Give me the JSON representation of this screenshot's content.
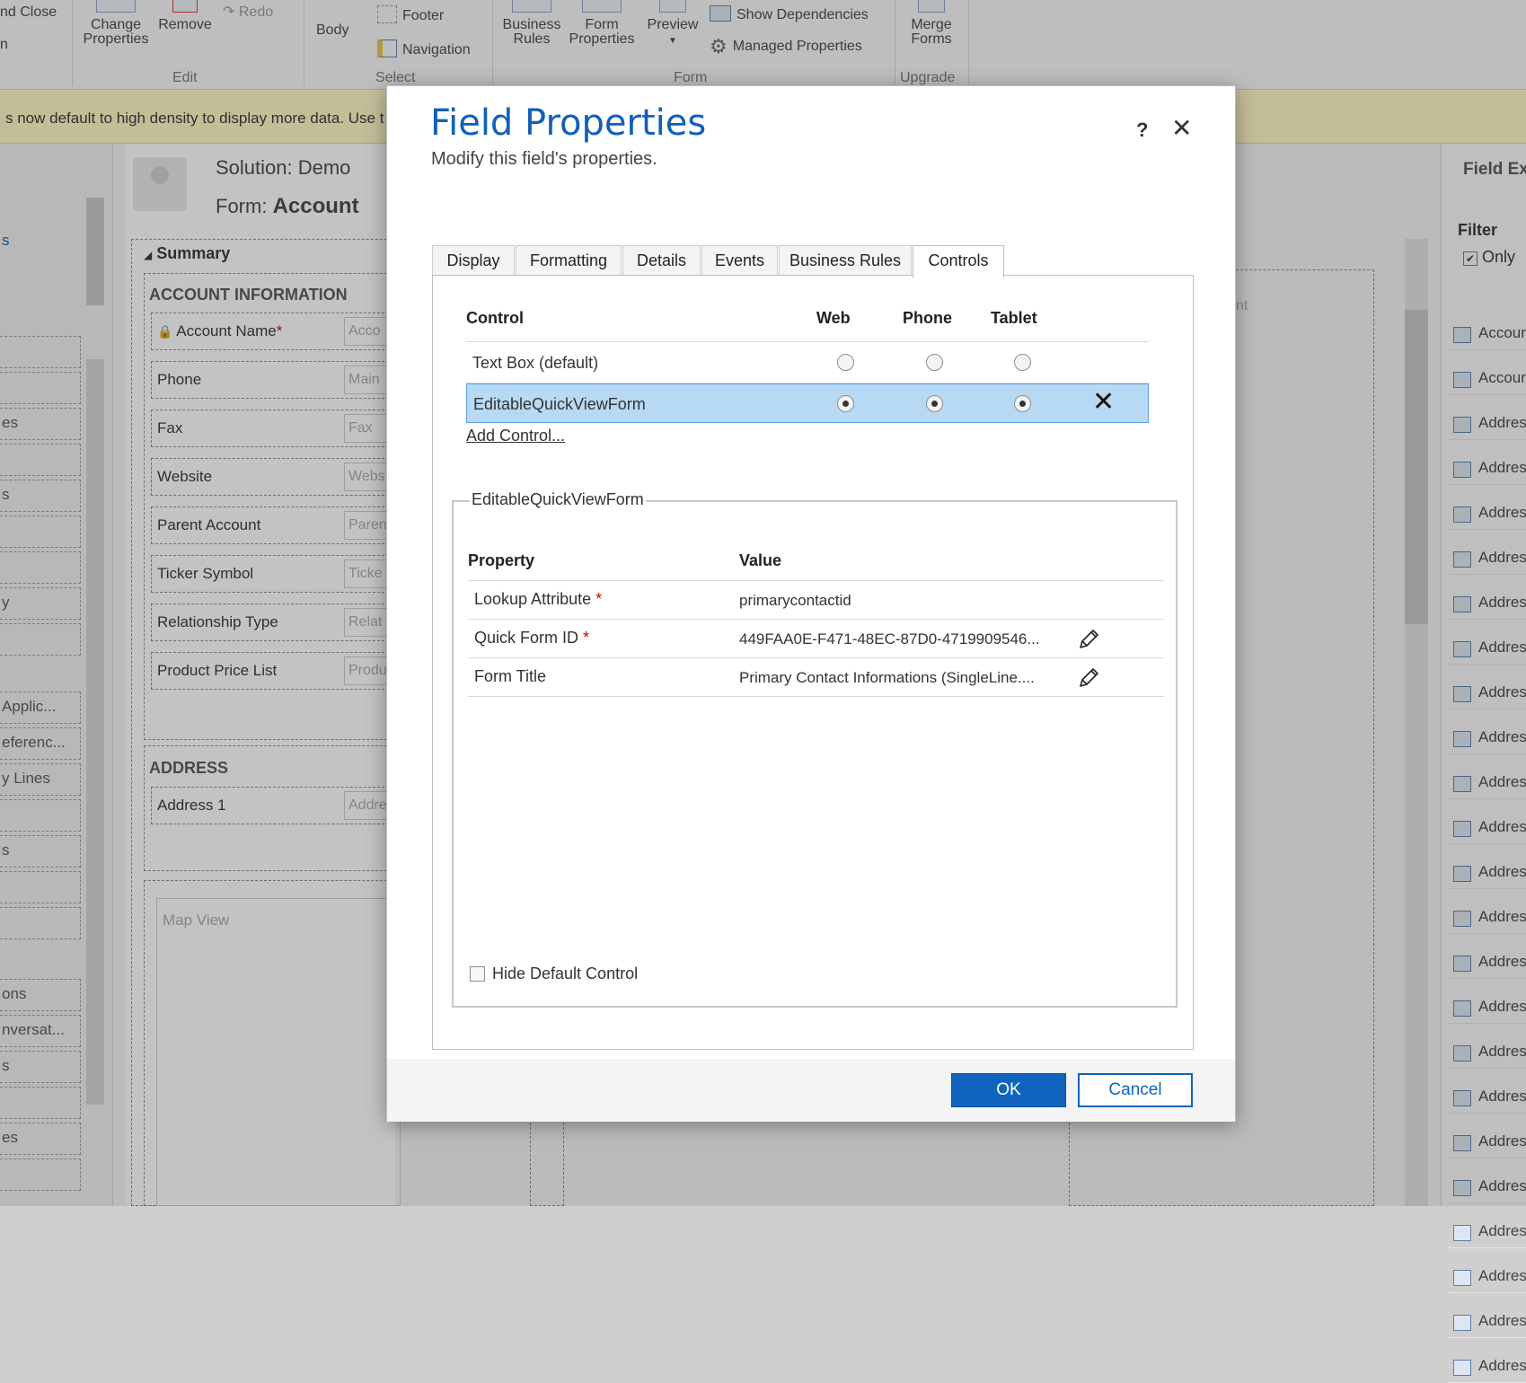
{
  "ribbon": {
    "save_close": "nd Close",
    "cut_label": "n",
    "change_properties": [
      "Change",
      "Properties"
    ],
    "remove": "Remove",
    "redo": "Redo",
    "edit_group": "Edit",
    "body": "Body",
    "footer": "Footer",
    "navigation": "Navigation",
    "select_group": "Select",
    "business_rules": [
      "Business",
      "Rules"
    ],
    "form_properties": [
      "Form",
      "Properties"
    ],
    "preview": "Preview",
    "show_dependencies": "Show Dependencies",
    "managed_properties": "Managed Properties",
    "form_group": "Form",
    "merge_forms": [
      "Merge",
      "Forms"
    ],
    "upgrade_group": "Upgrade"
  },
  "notice": {
    "text": "s now default to high density to display more data. Use t"
  },
  "left_nav": {
    "items": [
      "s",
      "es",
      "s",
      "y",
      "Applic...",
      "eferenc...",
      "y Lines",
      "s",
      "ons",
      "nversat...",
      "s",
      "es"
    ]
  },
  "form_canvas": {
    "solution_label": "Solution: Demo",
    "form_prefix": "Form:",
    "form_name": "Account",
    "summary_tab": "Summary",
    "account_section": "ACCOUNT INFORMATION",
    "fields": [
      {
        "label": "Account Name",
        "required": "*",
        "placeholder": "Acco"
      },
      {
        "label": "Phone",
        "required": "",
        "placeholder": "Main"
      },
      {
        "label": "Fax",
        "required": "",
        "placeholder": "Fax"
      },
      {
        "label": "Website",
        "required": "",
        "placeholder": "Webs"
      },
      {
        "label": "Parent Account",
        "required": "",
        "placeholder": "Paren"
      },
      {
        "label": "Ticker Symbol",
        "required": "",
        "placeholder": "Ticke"
      },
      {
        "label": "Relationship Type",
        "required": "",
        "placeholder": "Relat"
      },
      {
        "label": "Product Price List",
        "required": "",
        "placeholder": "Produ"
      }
    ],
    "address_section": "ADDRESS",
    "address_field": {
      "label": "Address 1",
      "placeholder": "Addre"
    },
    "map_view": "Map View",
    "right_hint": "nt"
  },
  "field_explorer": {
    "title": "Field Ex",
    "filter_label": "Filter",
    "only_label": "Only",
    "items": [
      "Accour",
      "Accour",
      "Addres",
      "Addres",
      "Addres",
      "Addres",
      "Addres",
      "Addres",
      "Addres",
      "Addres",
      "Addres",
      "Addres",
      "Addres",
      "Addres",
      "Addres",
      "Addres",
      "Addres",
      "Addres",
      "Addres",
      "Addres",
      "Addres",
      "Addres",
      "Addres",
      "Addres"
    ]
  },
  "dialog": {
    "title": "Field Properties",
    "subtitle": "Modify this field's properties.",
    "help": "?",
    "close": "✕",
    "tabs": [
      "Display",
      "Formatting",
      "Details",
      "Events",
      "Business Rules",
      "Controls"
    ],
    "active_tab": "Controls",
    "controls_table": {
      "headers": {
        "control": "Control",
        "web": "Web",
        "phone": "Phone",
        "tablet": "Tablet"
      },
      "rows": [
        {
          "name": "Text Box (default)",
          "web": false,
          "phone": false,
          "tablet": false,
          "removable": false
        },
        {
          "name": "EditableQuickViewForm",
          "web": true,
          "phone": true,
          "tablet": true,
          "removable": true
        }
      ],
      "remove_glyph": "✕"
    },
    "add_control": "Add Control...",
    "control_props": {
      "legend": "EditableQuickViewForm",
      "headers": {
        "property": "Property",
        "value": "Value"
      },
      "rows": [
        {
          "property": "Lookup Attribute",
          "required": "*",
          "value": "primarycontactid",
          "editable": false
        },
        {
          "property": "Quick Form ID",
          "required": "*",
          "value": "449FAA0E-F471-48EC-87D0-4719909546...",
          "editable": true
        },
        {
          "property": "Form Title",
          "required": "",
          "value": "Primary Contact Informations (SingleLine....",
          "editable": true
        }
      ]
    },
    "hide_default_control": "Hide Default Control",
    "hide_default_checked": false,
    "ok": "OK",
    "cancel": "Cancel"
  },
  "colors": {
    "accent": "#1160b7",
    "selected_row": "#b8d9f3",
    "notice_bg": "#fff8c4",
    "required": "#cc0000"
  }
}
